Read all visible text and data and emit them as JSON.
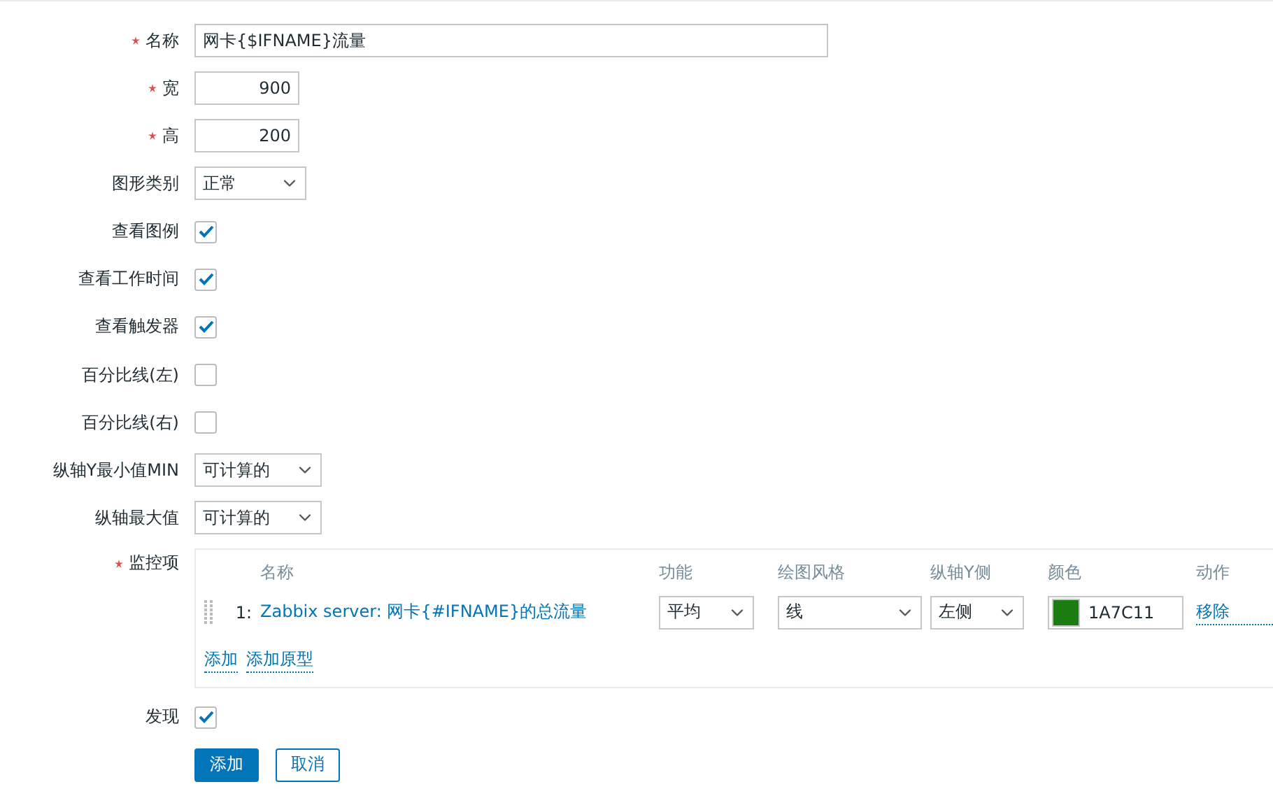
{
  "fields": [
    {
      "kind": "text",
      "label": "名称",
      "required": true,
      "value": "网卡{$IFNAME}流量"
    },
    {
      "kind": "number",
      "label": "宽",
      "required": true,
      "value": "900"
    },
    {
      "kind": "number",
      "label": "高",
      "required": true,
      "value": "200"
    },
    {
      "kind": "select",
      "label": "图形类别",
      "required": false,
      "value": "正常"
    },
    {
      "kind": "checkbox",
      "label": "查看图例",
      "required": false,
      "checked": true
    },
    {
      "kind": "checkbox",
      "label": "查看工作时间",
      "required": false,
      "checked": true
    },
    {
      "kind": "checkbox",
      "label": "查看触发器",
      "required": false,
      "checked": true
    },
    {
      "kind": "checkbox",
      "label": "百分比线(左)",
      "required": false,
      "checked": false
    },
    {
      "kind": "checkbox",
      "label": "百分比线(右)",
      "required": false,
      "checked": false
    },
    {
      "kind": "select",
      "label": "纵轴Y最小值MIN",
      "required": false,
      "value": "可计算的",
      "wide": true
    },
    {
      "kind": "select",
      "label": "纵轴最大值",
      "required": false,
      "value": "可计算的",
      "wide": true
    }
  ],
  "items": {
    "label": "监控项",
    "required": true,
    "columns": [
      "名称",
      "功能",
      "绘图风格",
      "纵轴Y侧",
      "颜色",
      "动作"
    ],
    "rows": [
      {
        "number": "1:",
        "name": "Zabbix server: 网卡{#IFNAME}的总流量",
        "function": "平均",
        "style": "线",
        "axis": "左侧",
        "color": "1A7C11",
        "action": "移除"
      }
    ],
    "links": [
      "添加",
      "添加原型"
    ]
  },
  "discover": {
    "label": "发现",
    "checked": true
  },
  "buttons": [
    {
      "label": "添加",
      "primary": true
    },
    {
      "label": "取消",
      "primary": false
    }
  ]
}
